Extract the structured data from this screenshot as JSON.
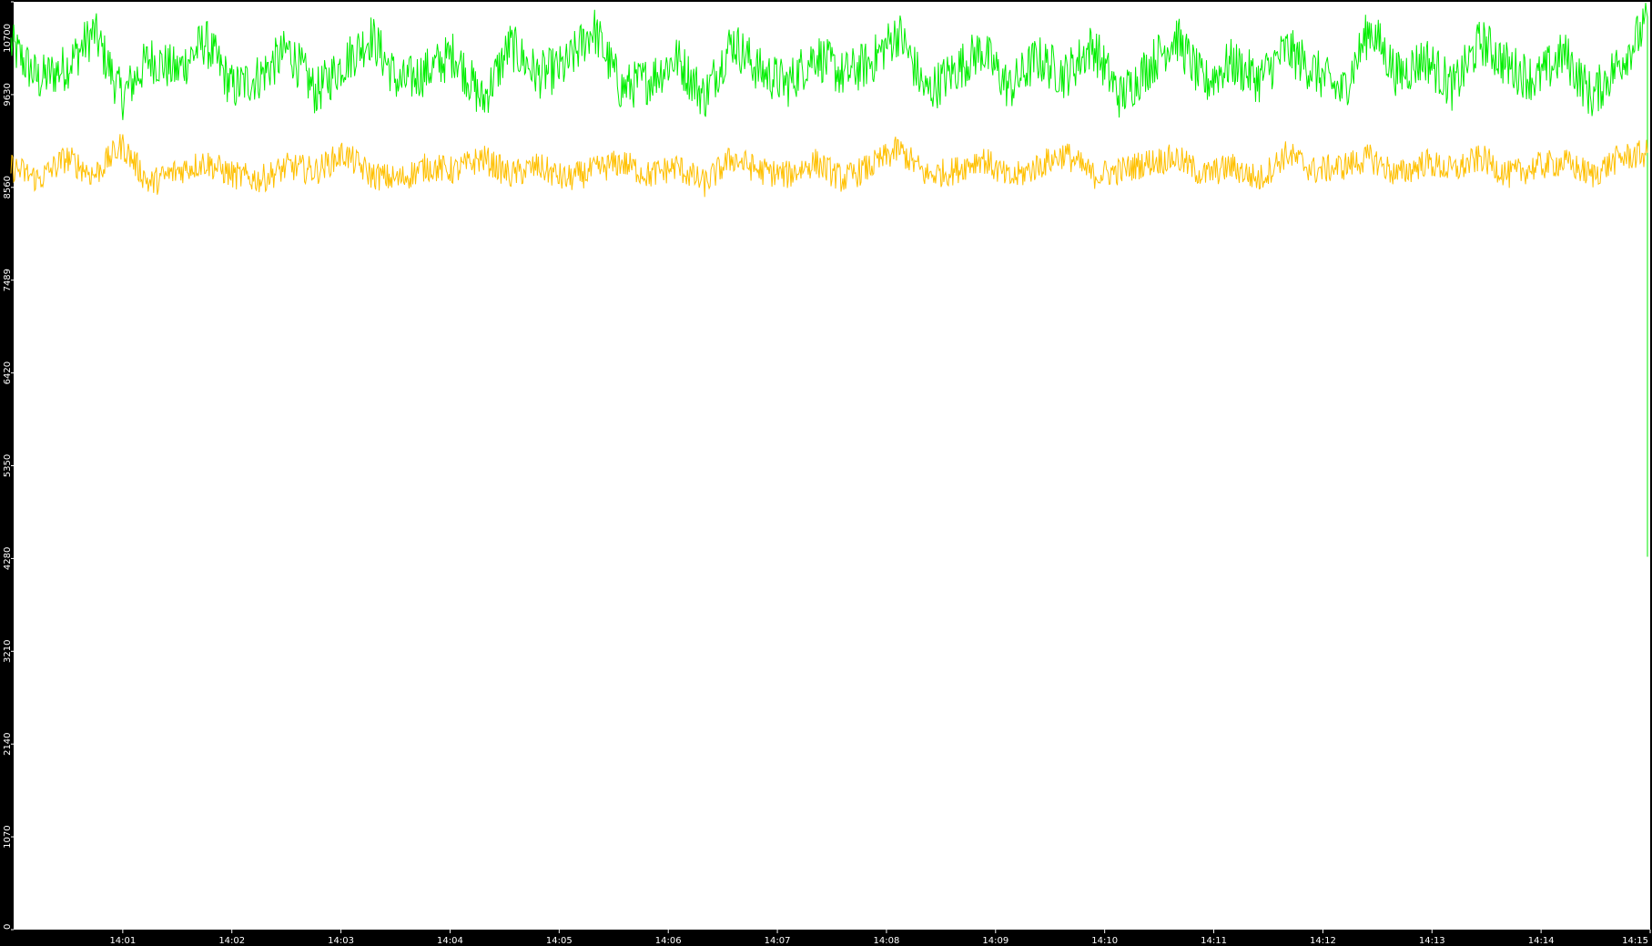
{
  "chart_data": {
    "type": "line",
    "title": "",
    "xlabel": "",
    "ylabel": "",
    "ylim": [
      0,
      10700
    ],
    "y_ticks": [
      "0",
      "1070",
      "2140",
      "3210",
      "4280",
      "5350",
      "6420",
      "7489",
      "8560",
      "9630",
      "10700"
    ],
    "x_ticks": [
      "14:01",
      "14:02",
      "14:03",
      "14:04",
      "14:05",
      "14:06",
      "14:07",
      "14:08",
      "14:09",
      "14:10",
      "14:11",
      "14:12",
      "14:13",
      "14:14",
      "14:15"
    ],
    "x_axis_start": "14:00",
    "x_range_minutes": [
      0,
      15
    ],
    "grid": false,
    "legend": "none",
    "background": "#ffffff",
    "frame_color": "#000000",
    "series": [
      {
        "color": "#00ee00",
        "approx_mean": 9850,
        "approx_min": 9100,
        "approx_max": 10700,
        "end_drop_value": 4300,
        "sampled_values": [
          10200,
          9800,
          9950,
          10350,
          9600,
          10050,
          9900,
          10250,
          9700,
          9850,
          10150,
          9650,
          10000,
          10300,
          9750,
          9900,
          10100,
          9550,
          10200,
          9850,
          9950,
          10400,
          9700,
          9800,
          10050,
          9600,
          10250,
          9900,
          9750,
          10100,
          9850,
          10000,
          10350,
          9650,
          9900,
          10150,
          9700,
          10050,
          9850,
          10200,
          9600,
          9950,
          10300,
          9750,
          10000,
          9800,
          10150,
          9900,
          9650,
          10400,
          9850,
          10050,
          9700,
          10250,
          9950,
          9800,
          10100,
          9600,
          10000,
          10450
        ]
      },
      {
        "color": "#ffc000",
        "approx_mean": 8760,
        "approx_min": 8300,
        "approx_max": 9250,
        "sampled_values": [
          8800,
          8650,
          8900,
          8700,
          9050,
          8600,
          8750,
          8850,
          8700,
          8650,
          8800,
          8750,
          8950,
          8700,
          8650,
          8800,
          8750,
          8900,
          8700,
          8800,
          8650,
          8750,
          8850,
          8700,
          8800,
          8600,
          8900,
          8750,
          8700,
          8850,
          8650,
          8800,
          9000,
          8700,
          8750,
          8900,
          8650,
          8800,
          8950,
          8700,
          8750,
          8850,
          8900,
          8700,
          8800,
          8650,
          8950,
          8750,
          8800,
          8900,
          8700,
          8850,
          8750,
          8900,
          8700,
          8800,
          8850,
          8700,
          8900,
          8950
        ]
      }
    ]
  }
}
